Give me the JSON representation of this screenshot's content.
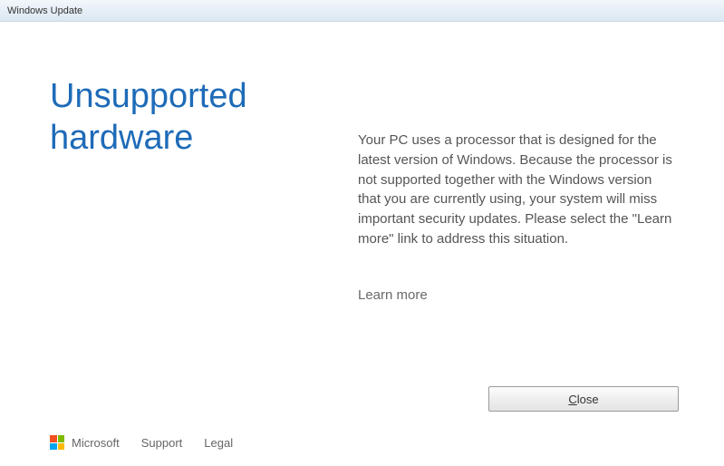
{
  "window": {
    "title": "Windows Update"
  },
  "main": {
    "heading": "Unsupported hardware",
    "body": "Your PC uses a processor that is designed for the latest version of Windows. Because the processor is not supported together with the Windows version that you are currently using, your system will miss important security updates. Please select the \"Learn more\" link to address this situation.",
    "learn_more": "Learn more",
    "close_prefix": "",
    "close_access": "C",
    "close_suffix": "lose"
  },
  "footer": {
    "brand": "Microsoft",
    "support": "Support",
    "legal": "Legal"
  }
}
